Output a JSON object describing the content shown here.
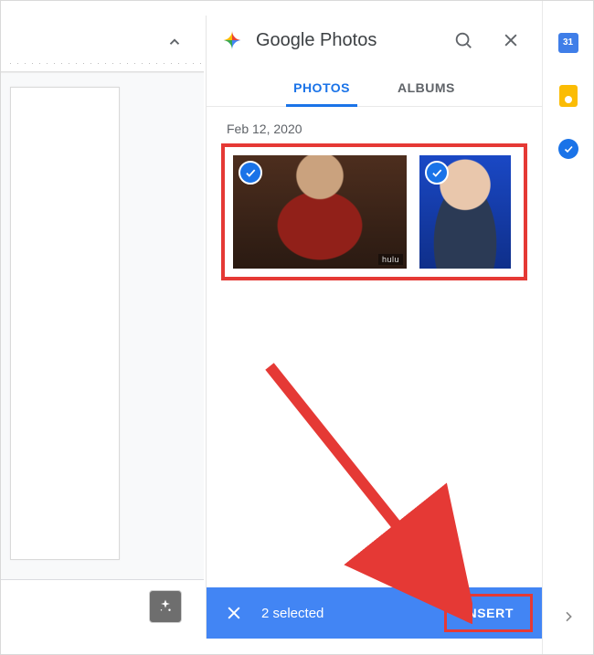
{
  "header": {
    "title": "Google Photos"
  },
  "tabs": {
    "photos": "PHOTOS",
    "albums": "ALBUMS",
    "active": "photos"
  },
  "dateGroup": {
    "label": "Feb 12, 2020"
  },
  "thumbs": {
    "0": {
      "selected": true,
      "tag": "hulu"
    },
    "1": {
      "selected": true
    }
  },
  "footer": {
    "selected_text": "2 selected",
    "insert_label": "INSERT"
  },
  "rail": {
    "calendar_day": "31"
  }
}
